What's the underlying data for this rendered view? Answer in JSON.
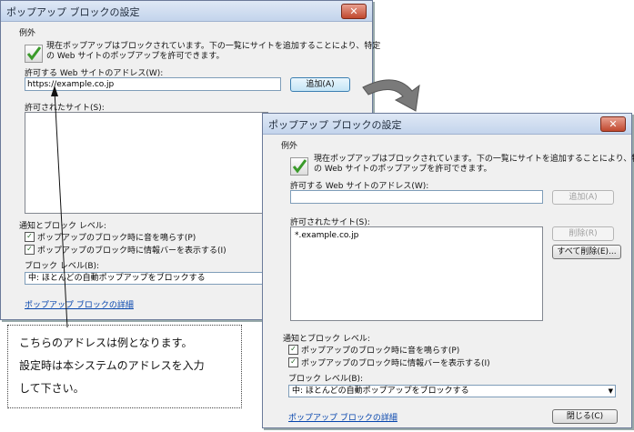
{
  "dialog1": {
    "title": "ポップアップ ブロックの設定",
    "close_glyph": "✕",
    "exceptions_label": "例外",
    "info_line1": "現在ポップアップはブロックされています。下の一覧にサイトを追加することにより、特定",
    "info_line2": "の Web サイトのポップアップを許可できます。",
    "address_label": "許可する Web サイトのアドレス(W):",
    "address_value": "https://example.co.jp",
    "add_button": "追加(A)",
    "allowed_label": "許可されたサイト(S):",
    "notify_label": "通知とブロック レベル:",
    "check1": "ポップアップのブロック時に音を鳴らす(P)",
    "check2": "ポップアップのブロック時に情報バーを表示する(I)",
    "block_level_label": "ブロック レベル(B):",
    "block_level_value": "中: ほとんどの自動ポップアップをブロックする",
    "details_link": "ポップアップ ブロックの詳細"
  },
  "dialog2": {
    "title": "ポップアップ ブロックの設定",
    "close_glyph": "✕",
    "exceptions_label": "例外",
    "info_line1": "現在ポップアップはブロックされています。下の一覧にサイトを追加することにより、特定",
    "info_line2": "の Web サイトのポップアップを許可できます。",
    "address_label": "許可する Web サイトのアドレス(W):",
    "address_value": "",
    "add_button": "追加(A)",
    "allowed_label": "許可されたサイト(S):",
    "allowed_sites": [
      "*.example.co.jp"
    ],
    "remove_button": "削除(R)",
    "remove_all_button": "すべて削除(E)...",
    "notify_label": "通知とブロック レベル:",
    "check1": "ポップアップのブロック時に音を鳴らす(P)",
    "check2": "ポップアップのブロック時に情報バーを表示する(I)",
    "block_level_label": "ブロック レベル(B):",
    "block_level_value": "中: ほとんどの自動ポップアップをブロックする",
    "details_link": "ポップアップ ブロックの詳細",
    "close_button": "閉じる(C)"
  },
  "note": {
    "line1": "こちらのアドレスは例となります。",
    "line2": "設定時は本システムのアドレスを入力",
    "line3": "して下さい。"
  },
  "icons": {
    "check_mark": "✓",
    "dropdown": "▼"
  }
}
